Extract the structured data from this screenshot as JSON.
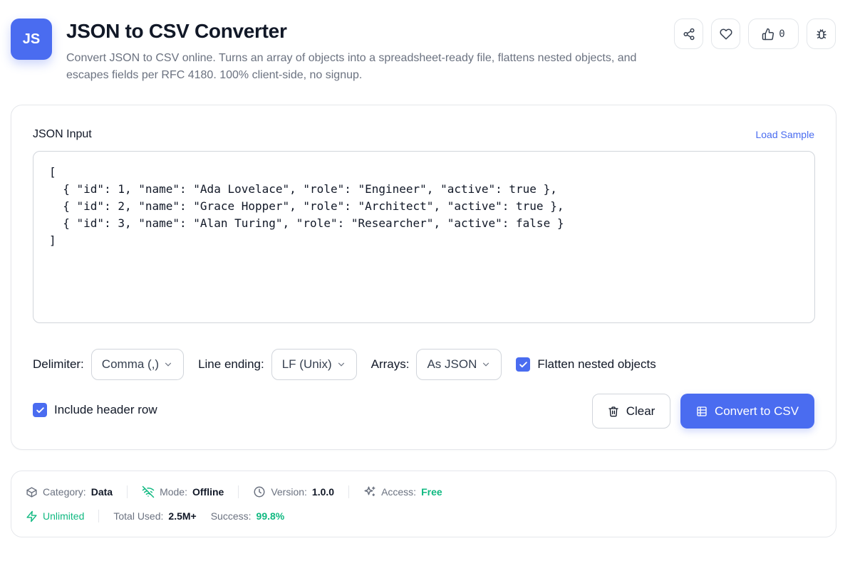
{
  "header": {
    "logo_text": "JS",
    "title": "JSON to CSV Converter",
    "subtitle": "Convert JSON to CSV online. Turns an array of objects into a spreadsheet-ready file, flattens nested objects, and escapes fields per RFC 4180. 100% client-side, no signup.",
    "like_count": "0",
    "actions": [
      "share-icon",
      "heart-icon",
      "thumbs-up-icon",
      "bug-icon"
    ]
  },
  "input": {
    "label": "JSON Input",
    "load_sample": "Load Sample",
    "value": "[\n  { \"id\": 1, \"name\": \"Ada Lovelace\", \"role\": \"Engineer\", \"active\": true },\n  { \"id\": 2, \"name\": \"Grace Hopper\", \"role\": \"Architect\", \"active\": true },\n  { \"id\": 3, \"name\": \"Alan Turing\", \"role\": \"Researcher\", \"active\": false }\n]"
  },
  "options": {
    "delimiter_label": "Delimiter:",
    "delimiter_value": "Comma (,)",
    "line_ending_label": "Line ending:",
    "line_ending_value": "LF (Unix)",
    "arrays_label": "Arrays:",
    "arrays_value": "As JSON",
    "flatten_label": "Flatten nested objects",
    "flatten_checked": true,
    "header_row_label": "Include header row",
    "header_row_checked": true
  },
  "buttons": {
    "clear": "Clear",
    "convert": "Convert to CSV"
  },
  "meta": {
    "category_label": "Category:",
    "category_value": "Data",
    "mode_label": "Mode:",
    "mode_value": "Offline",
    "version_label": "Version:",
    "version_value": "1.0.0",
    "access_label": "Access:",
    "access_value": "Free",
    "unlimited": "Unlimited",
    "total_used_label": "Total Used:",
    "total_used_value": "2.5M+",
    "success_label": "Success:",
    "success_value": "99.8%"
  },
  "colors": {
    "accent": "#4a6cf0",
    "success": "#10b981",
    "muted": "#6b7280"
  }
}
